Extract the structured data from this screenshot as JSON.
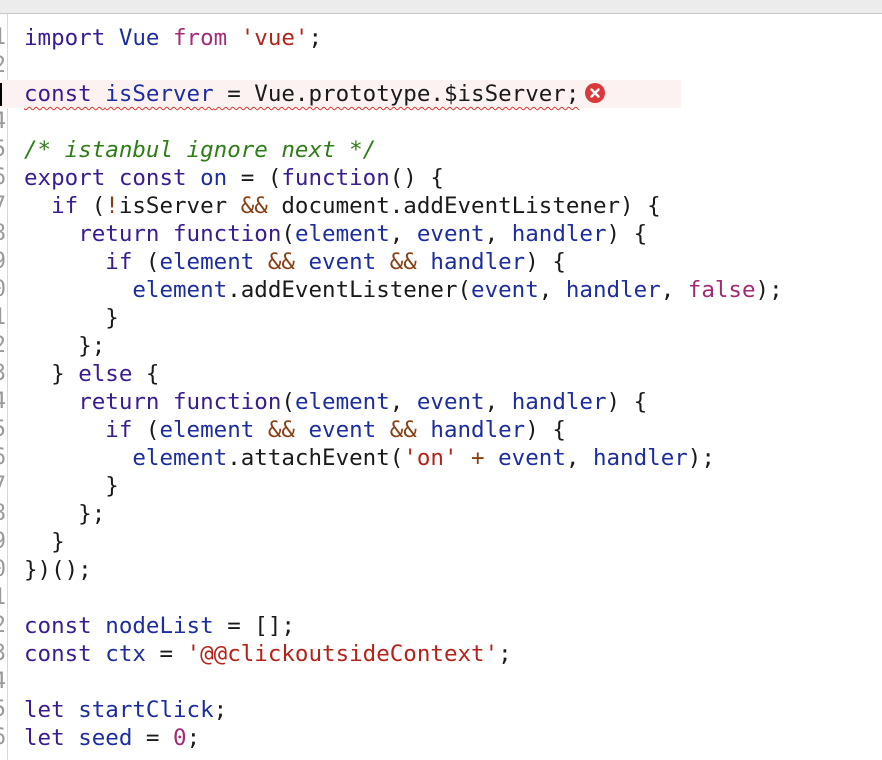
{
  "colors": {
    "keyword": "#a22b75",
    "keyword2": "#3b1b91",
    "name": "#1c2d9f",
    "operator": "#8a3f12",
    "string": "#b42319",
    "comment": "#2e7d17",
    "plain": "#1a1a1a",
    "error": "#d9393a"
  },
  "gutter": {
    "line_numbers": [
      "1",
      "2",
      "3",
      "4",
      "5",
      "6",
      "7",
      "8",
      "9",
      "0",
      "1",
      "2",
      "3",
      "4",
      "5",
      "6",
      "7",
      "8",
      "9",
      "0",
      "1",
      "2",
      "3",
      "4",
      "5",
      "6"
    ]
  },
  "editor": {
    "error_line_index": 2,
    "error_icon": "error-circle-icon",
    "lines": [
      [
        {
          "t": "keyword2",
          "v": "import "
        },
        {
          "t": "name",
          "v": "Vue "
        },
        {
          "t": "keyword",
          "v": "from "
        },
        {
          "t": "string",
          "v": "'vue'"
        },
        {
          "t": "plain",
          "v": ";"
        }
      ],
      [],
      [
        {
          "t": "keyword2",
          "v": "const "
        },
        {
          "t": "name",
          "v": "isServer"
        },
        {
          "t": "plain",
          "v": " = Vue.prototype.$isServer;"
        }
      ],
      [],
      [
        {
          "t": "comment",
          "v": "/* istanbul ignore next */"
        }
      ],
      [
        {
          "t": "keyword2",
          "v": "export "
        },
        {
          "t": "keyword2",
          "v": "const "
        },
        {
          "t": "name",
          "v": "on"
        },
        {
          "t": "plain",
          "v": " = ("
        },
        {
          "t": "keyword2",
          "v": "function"
        },
        {
          "t": "plain",
          "v": "() {"
        }
      ],
      [
        {
          "t": "plain",
          "v": "  "
        },
        {
          "t": "keyword2",
          "v": "if"
        },
        {
          "t": "plain",
          "v": " ("
        },
        {
          "t": "op",
          "v": "!"
        },
        {
          "t": "plain",
          "v": "isServer "
        },
        {
          "t": "op",
          "v": "&&"
        },
        {
          "t": "plain",
          "v": " document.addEventListener) {"
        }
      ],
      [
        {
          "t": "plain",
          "v": "    "
        },
        {
          "t": "keyword2",
          "v": "return "
        },
        {
          "t": "keyword2",
          "v": "function"
        },
        {
          "t": "plain",
          "v": "("
        },
        {
          "t": "name",
          "v": "element"
        },
        {
          "t": "plain",
          "v": ", "
        },
        {
          "t": "name",
          "v": "event"
        },
        {
          "t": "plain",
          "v": ", "
        },
        {
          "t": "name",
          "v": "handler"
        },
        {
          "t": "plain",
          "v": ") {"
        }
      ],
      [
        {
          "t": "plain",
          "v": "      "
        },
        {
          "t": "keyword2",
          "v": "if"
        },
        {
          "t": "plain",
          "v": " ("
        },
        {
          "t": "name",
          "v": "element"
        },
        {
          "t": "plain",
          "v": " "
        },
        {
          "t": "op",
          "v": "&&"
        },
        {
          "t": "plain",
          "v": " "
        },
        {
          "t": "name",
          "v": "event"
        },
        {
          "t": "plain",
          "v": " "
        },
        {
          "t": "op",
          "v": "&&"
        },
        {
          "t": "plain",
          "v": " "
        },
        {
          "t": "name",
          "v": "handler"
        },
        {
          "t": "plain",
          "v": ") {"
        }
      ],
      [
        {
          "t": "plain",
          "v": "        "
        },
        {
          "t": "name",
          "v": "element"
        },
        {
          "t": "plain",
          "v": ".addEventListener("
        },
        {
          "t": "name",
          "v": "event"
        },
        {
          "t": "plain",
          "v": ", "
        },
        {
          "t": "name",
          "v": "handler"
        },
        {
          "t": "plain",
          "v": ", "
        },
        {
          "t": "keyword",
          "v": "false"
        },
        {
          "t": "plain",
          "v": ");"
        }
      ],
      [
        {
          "t": "plain",
          "v": "      }"
        }
      ],
      [
        {
          "t": "plain",
          "v": "    };"
        }
      ],
      [
        {
          "t": "plain",
          "v": "  } "
        },
        {
          "t": "keyword2",
          "v": "else"
        },
        {
          "t": "plain",
          "v": " {"
        }
      ],
      [
        {
          "t": "plain",
          "v": "    "
        },
        {
          "t": "keyword2",
          "v": "return "
        },
        {
          "t": "keyword2",
          "v": "function"
        },
        {
          "t": "plain",
          "v": "("
        },
        {
          "t": "name",
          "v": "element"
        },
        {
          "t": "plain",
          "v": ", "
        },
        {
          "t": "name",
          "v": "event"
        },
        {
          "t": "plain",
          "v": ", "
        },
        {
          "t": "name",
          "v": "handler"
        },
        {
          "t": "plain",
          "v": ") {"
        }
      ],
      [
        {
          "t": "plain",
          "v": "      "
        },
        {
          "t": "keyword2",
          "v": "if"
        },
        {
          "t": "plain",
          "v": " ("
        },
        {
          "t": "name",
          "v": "element"
        },
        {
          "t": "plain",
          "v": " "
        },
        {
          "t": "op",
          "v": "&&"
        },
        {
          "t": "plain",
          "v": " "
        },
        {
          "t": "name",
          "v": "event"
        },
        {
          "t": "plain",
          "v": " "
        },
        {
          "t": "op",
          "v": "&&"
        },
        {
          "t": "plain",
          "v": " "
        },
        {
          "t": "name",
          "v": "handler"
        },
        {
          "t": "plain",
          "v": ") {"
        }
      ],
      [
        {
          "t": "plain",
          "v": "        "
        },
        {
          "t": "name",
          "v": "element"
        },
        {
          "t": "plain",
          "v": ".attachEvent("
        },
        {
          "t": "string",
          "v": "'on'"
        },
        {
          "t": "plain",
          "v": " "
        },
        {
          "t": "op",
          "v": "+"
        },
        {
          "t": "plain",
          "v": " "
        },
        {
          "t": "name",
          "v": "event"
        },
        {
          "t": "plain",
          "v": ", "
        },
        {
          "t": "name",
          "v": "handler"
        },
        {
          "t": "plain",
          "v": ");"
        }
      ],
      [
        {
          "t": "plain",
          "v": "      }"
        }
      ],
      [
        {
          "t": "plain",
          "v": "    };"
        }
      ],
      [
        {
          "t": "plain",
          "v": "  }"
        }
      ],
      [
        {
          "t": "plain",
          "v": "})();"
        }
      ],
      [],
      [
        {
          "t": "keyword2",
          "v": "const "
        },
        {
          "t": "name",
          "v": "nodeList"
        },
        {
          "t": "plain",
          "v": " = [];"
        }
      ],
      [
        {
          "t": "keyword2",
          "v": "const "
        },
        {
          "t": "name",
          "v": "ctx"
        },
        {
          "t": "plain",
          "v": " = "
        },
        {
          "t": "string",
          "v": "'@@clickoutsideContext'"
        },
        {
          "t": "plain",
          "v": ";"
        }
      ],
      [],
      [
        {
          "t": "keyword2",
          "v": "let "
        },
        {
          "t": "name",
          "v": "startClick"
        },
        {
          "t": "plain",
          "v": ";"
        }
      ],
      [
        {
          "t": "keyword2",
          "v": "let "
        },
        {
          "t": "name",
          "v": "seed"
        },
        {
          "t": "plain",
          "v": " = "
        },
        {
          "t": "keyword",
          "v": "0"
        },
        {
          "t": "plain",
          "v": ";"
        }
      ]
    ]
  }
}
